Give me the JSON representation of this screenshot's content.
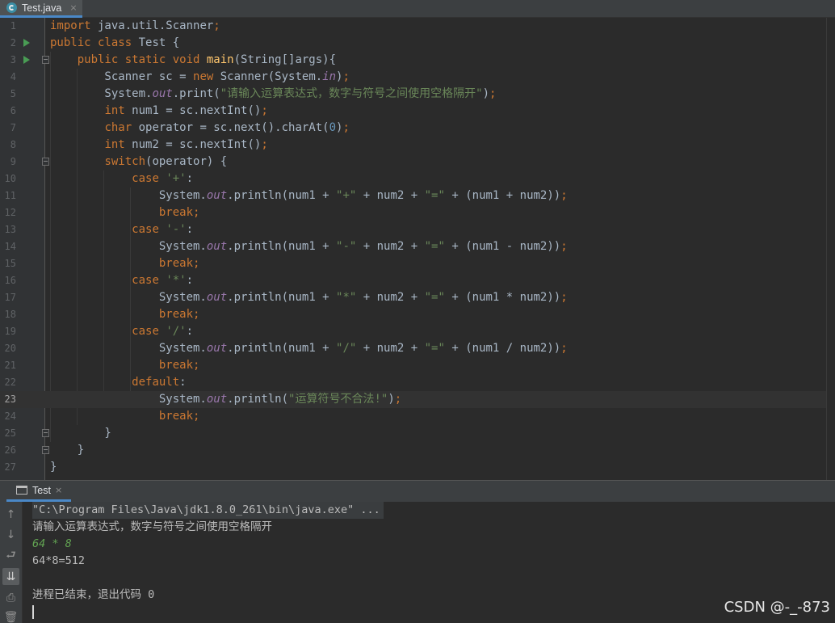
{
  "editor_tab": {
    "label": "Test.java",
    "close": "×"
  },
  "code_lines": [
    [
      {
        "t": "import",
        "c": "kw"
      },
      {
        "t": " java.util.Scanner"
      },
      {
        "t": ";",
        "c": "kw"
      }
    ],
    [
      {
        "t": "public class",
        "c": "kw"
      },
      {
        "t": " Test {"
      }
    ],
    [
      {
        "t": "    "
      },
      {
        "t": "public static void",
        "c": "kw"
      },
      {
        "t": " "
      },
      {
        "t": "main",
        "c": "fn"
      },
      {
        "t": "(String[]args){"
      }
    ],
    [
      {
        "t": "        Scanner sc = "
      },
      {
        "t": "new",
        "c": "kw"
      },
      {
        "t": " Scanner(System."
      },
      {
        "t": "in",
        "c": "fld"
      },
      {
        "t": ")"
      },
      {
        "t": ";",
        "c": "kw"
      }
    ],
    [
      {
        "t": "        System."
      },
      {
        "t": "out",
        "c": "fld"
      },
      {
        "t": ".print("
      },
      {
        "t": "\"请输入运算表达式，数字与符号之间使用空格隔开\"",
        "c": "st"
      },
      {
        "t": ")"
      },
      {
        "t": ";",
        "c": "kw"
      }
    ],
    [
      {
        "t": "        "
      },
      {
        "t": "int",
        "c": "kw"
      },
      {
        "t": " num1 = sc.nextInt()"
      },
      {
        "t": ";",
        "c": "kw"
      }
    ],
    [
      {
        "t": "        "
      },
      {
        "t": "char",
        "c": "kw"
      },
      {
        "t": " operator = sc.next().charAt("
      },
      {
        "t": "0",
        "c": "num"
      },
      {
        "t": ")"
      },
      {
        "t": ";",
        "c": "kw"
      }
    ],
    [
      {
        "t": "        "
      },
      {
        "t": "int",
        "c": "kw"
      },
      {
        "t": " num2 = sc.nextInt()"
      },
      {
        "t": ";",
        "c": "kw"
      }
    ],
    [
      {
        "t": "        "
      },
      {
        "t": "switch",
        "c": "kw"
      },
      {
        "t": "(operator) {"
      }
    ],
    [
      {
        "t": "            "
      },
      {
        "t": "case",
        "c": "kw"
      },
      {
        "t": " "
      },
      {
        "t": "'+'",
        "c": "st"
      },
      {
        "t": ":"
      }
    ],
    [
      {
        "t": "                System."
      },
      {
        "t": "out",
        "c": "fld"
      },
      {
        "t": ".println(num1 + "
      },
      {
        "t": "\"+\"",
        "c": "st"
      },
      {
        "t": " + num2 + "
      },
      {
        "t": "\"=\"",
        "c": "st"
      },
      {
        "t": " + (num1 + num2))"
      },
      {
        "t": ";",
        "c": "kw"
      }
    ],
    [
      {
        "t": "                "
      },
      {
        "t": "break;",
        "c": "kw"
      }
    ],
    [
      {
        "t": "            "
      },
      {
        "t": "case",
        "c": "kw"
      },
      {
        "t": " "
      },
      {
        "t": "'-'",
        "c": "st"
      },
      {
        "t": ":"
      }
    ],
    [
      {
        "t": "                System."
      },
      {
        "t": "out",
        "c": "fld"
      },
      {
        "t": ".println(num1 + "
      },
      {
        "t": "\"-\"",
        "c": "st"
      },
      {
        "t": " + num2 + "
      },
      {
        "t": "\"=\"",
        "c": "st"
      },
      {
        "t": " + (num1 - num2))"
      },
      {
        "t": ";",
        "c": "kw"
      }
    ],
    [
      {
        "t": "                "
      },
      {
        "t": "break;",
        "c": "kw"
      }
    ],
    [
      {
        "t": "            "
      },
      {
        "t": "case",
        "c": "kw"
      },
      {
        "t": " "
      },
      {
        "t": "'*'",
        "c": "st"
      },
      {
        "t": ":"
      }
    ],
    [
      {
        "t": "                System."
      },
      {
        "t": "out",
        "c": "fld"
      },
      {
        "t": ".println(num1 + "
      },
      {
        "t": "\"*\"",
        "c": "st"
      },
      {
        "t": " + num2 + "
      },
      {
        "t": "\"=\"",
        "c": "st"
      },
      {
        "t": " + (num1 * num2))"
      },
      {
        "t": ";",
        "c": "kw"
      }
    ],
    [
      {
        "t": "                "
      },
      {
        "t": "break;",
        "c": "kw"
      }
    ],
    [
      {
        "t": "            "
      },
      {
        "t": "case",
        "c": "kw"
      },
      {
        "t": " "
      },
      {
        "t": "'/'",
        "c": "st"
      },
      {
        "t": ":"
      }
    ],
    [
      {
        "t": "                System."
      },
      {
        "t": "out",
        "c": "fld"
      },
      {
        "t": ".println(num1 + "
      },
      {
        "t": "\"/\"",
        "c": "st"
      },
      {
        "t": " + num2 + "
      },
      {
        "t": "\"=\"",
        "c": "st"
      },
      {
        "t": " + (num1 / num2))"
      },
      {
        "t": ";",
        "c": "kw"
      }
    ],
    [
      {
        "t": "                "
      },
      {
        "t": "break;",
        "c": "kw"
      }
    ],
    [
      {
        "t": "            "
      },
      {
        "t": "default",
        "c": "kw"
      },
      {
        "t": ":"
      }
    ],
    [
      {
        "t": "                System."
      },
      {
        "t": "out",
        "c": "fld"
      },
      {
        "t": ".println("
      },
      {
        "t": "\"运算符号不合法!\"",
        "c": "st"
      },
      {
        "t": ")"
      },
      {
        "t": ";",
        "c": "kw"
      }
    ],
    [
      {
        "t": "                "
      },
      {
        "t": "break;",
        "c": "kw"
      }
    ],
    [
      {
        "t": "        }"
      }
    ],
    [
      {
        "t": "    }"
      }
    ],
    [
      {
        "t": "}"
      }
    ]
  ],
  "line_numbers": [
    "1",
    "2",
    "3",
    "4",
    "5",
    "6",
    "7",
    "8",
    "9",
    "10",
    "11",
    "12",
    "13",
    "14",
    "15",
    "16",
    "17",
    "18",
    "19",
    "20",
    "21",
    "22",
    "23",
    "24",
    "25",
    "26",
    "27"
  ],
  "current_line": 23,
  "run_gutter_lines": [
    2,
    3
  ],
  "fold_lines": [
    3,
    9,
    25,
    26
  ],
  "run_window": {
    "tab_label": "Test",
    "tab_close": "×",
    "toolbar_icons": [
      "arrow-up-icon",
      "arrow-down-icon",
      "soft-wrap-icon",
      "scroll-to-end-icon",
      "print-icon",
      "trash-icon"
    ],
    "console": {
      "command": "\"C:\\Program Files\\Java\\jdk1.8.0_261\\bin\\java.exe\" ...",
      "prompt": "请输入运算表达式，数字与符号之间使用空格隔开",
      "user_input": "64 * 8",
      "result": "64*8=512",
      "blank": "",
      "exit_message": "进程已结束，退出代码 0"
    }
  },
  "watermark": "CSDN @-_-873",
  "colors": {
    "keyword": "#cc7832",
    "method": "#ffc66d",
    "string": "#6a8759",
    "field": "#9876aa",
    "number": "#6897bb",
    "text": "#a9b7c6",
    "run_marker": "#499c54",
    "console_input": "#62a352"
  }
}
